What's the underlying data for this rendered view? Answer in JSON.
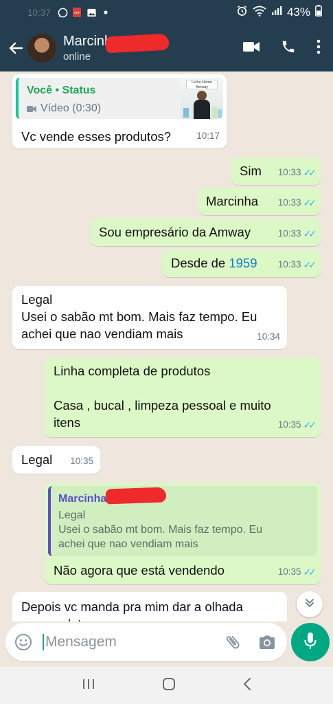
{
  "status_bar": {
    "time": "10:37",
    "battery": "43%",
    "pdf_badge": "PDF"
  },
  "header": {
    "contact_name": "Marcinha",
    "contact_status": "online"
  },
  "messages": [
    {
      "direction": "in",
      "quote": {
        "author": "Você • Status",
        "media": "Vídeo (0:30)",
        "thumb_caption": "Linha Home Amway"
      },
      "text": "Vc vende esses produtos?",
      "time": "10:17"
    },
    {
      "direction": "out",
      "text": "Sim",
      "time": "10:33",
      "read": true
    },
    {
      "direction": "out",
      "text": "Marcinha",
      "time": "10:33",
      "read": true
    },
    {
      "direction": "out",
      "text": "Sou empresário da Amway",
      "time": "10:33",
      "read": true
    },
    {
      "direction": "out",
      "text_prefix": "Desde de ",
      "link": "1959",
      "time": "10:33",
      "read": true
    },
    {
      "direction": "in",
      "lines": [
        "Legal",
        "Usei o sabão mt bom. Mais faz tempo. Eu",
        "achei que nao vendiam mais"
      ],
      "time": "10:34"
    },
    {
      "direction": "out",
      "lines": [
        "Linha completa de produtos",
        "",
        "Casa , bucal , limpeza pessoal e muito",
        "itens"
      ],
      "time": "10:35",
      "read": true
    },
    {
      "direction": "in",
      "text": "Legal",
      "time": "10:35"
    },
    {
      "direction": "out",
      "quote": {
        "author": "Marcinha",
        "lines": [
          "Legal",
          "Usei o sabão mt bom. Mais faz tempo. Eu",
          "achei que nao vendiam mais"
        ]
      },
      "text": "Não agora que está vendendo",
      "time": "10:35",
      "read": true
    },
    {
      "direction": "in",
      "lines": [
        "Depois vc manda pra mim dar a olhada",
        "nos produtos"
      ]
    }
  ],
  "composer": {
    "placeholder": "Mensagem"
  },
  "colors": {
    "header": "#243e4f",
    "chat_background": "#efe7de",
    "outgoing_bubble": "#dcf8c6",
    "incoming_bubble": "#ffffff",
    "accent": "#00a884",
    "read_ticks": "#34b7f1"
  },
  "icons": [
    "whatsapp-icon",
    "pdf-icon",
    "gallery-icon",
    "alarm-icon",
    "wifi-icon",
    "signal-icon",
    "battery-icon",
    "back-arrow-icon",
    "video-call-icon",
    "phone-icon",
    "more-icon",
    "emoji-icon",
    "attach-icon",
    "camera-icon",
    "mic-icon",
    "chevrons-down-icon",
    "recents-icon",
    "home-icon",
    "nav-back-icon"
  ]
}
